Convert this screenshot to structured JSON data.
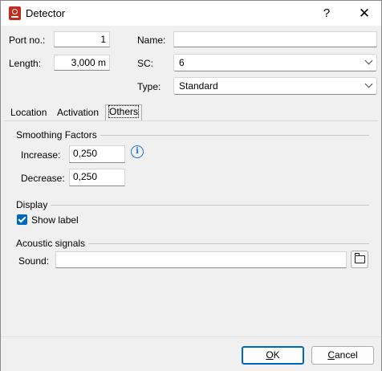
{
  "window": {
    "title": "Detector",
    "help_glyph": "?",
    "close_glyph": "✕"
  },
  "fields": {
    "port_label": "Port no.:",
    "port_value": "1",
    "length_label": "Length:",
    "length_value": "3,000 m",
    "name_label": "Name:",
    "name_value": "",
    "sc_label": "SC:",
    "sc_value": "6",
    "type_label": "Type:",
    "type_value": "Standard"
  },
  "tabs": [
    {
      "label": "Location"
    },
    {
      "label": "Activation"
    },
    {
      "label": "Others",
      "active": true
    }
  ],
  "others": {
    "smoothing_title": "Smoothing Factors",
    "increase_label": "Increase:",
    "increase_value": "0,250",
    "decrease_label": "Decrease:",
    "decrease_value": "0,250",
    "display_title": "Display",
    "show_label_text": "Show label",
    "show_label_checked": true,
    "acoustic_title": "Acoustic signals",
    "sound_label": "Sound:",
    "sound_value": ""
  },
  "buttons": {
    "ok_first": "O",
    "ok_rest": "K",
    "cancel_first": "C",
    "cancel_rest": "ancel"
  },
  "colors": {
    "accent": "#0067c0",
    "info": "#1a73c9",
    "app_icon": "#c42b1c"
  },
  "icons": [
    "app-detector-icon",
    "help-icon",
    "close-icon",
    "info-icon",
    "checkbox-checked-icon",
    "folder-open-icon",
    "chevron-down-icon"
  ]
}
